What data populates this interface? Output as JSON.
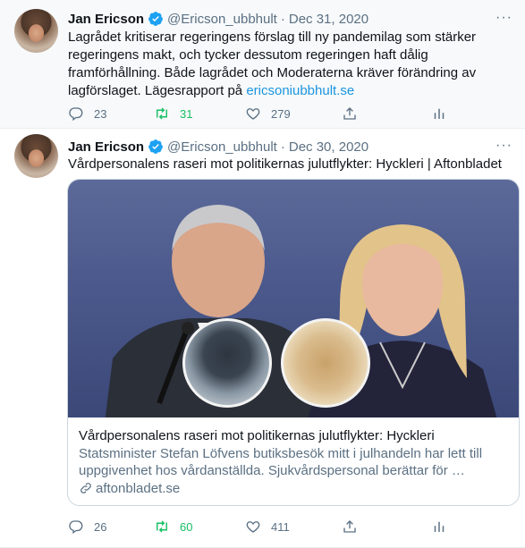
{
  "tweets": [
    {
      "name": "Jan Ericson",
      "handle": "@Ericson_ubbhult",
      "dot": "·",
      "date": "Dec 31, 2020",
      "more": "···",
      "text_line1": "Lagrådet kritiserar regeringens förslag till ny pandemilag som stärker",
      "text_line2": "regeringens makt, och tycker dessutom regeringen haft dålig",
      "text_line3": "framförhållning. Både lagrådet och Moderaterna kräver förändring av",
      "text_line4_prefix": "lagförslaget. Lägesrapport på ",
      "text_link": "ericsoniubbhult.se",
      "replies": "23",
      "retweets": "31",
      "likes": "279"
    },
    {
      "name": "Jan Ericson",
      "handle": "@Ericson_ubbhult",
      "dot": "·",
      "date": "Dec 30, 2020",
      "more": "···",
      "text_line1": "Vårdpersonalens raseri mot politikernas julutflykter: Hyckleri | Aftonbladet",
      "card": {
        "title": "Vårdpersonalens raseri mot politikernas julutflykter: Hyckleri",
        "desc_line1": "Statsminister Stefan Löfvens butiksbesök mitt i julhandeln har lett till",
        "desc_line2": "uppgivenhet hos vårdanställda. Sjukvårdspersonal berättar för …",
        "domain": "aftonbladet.se"
      },
      "replies": "26",
      "retweets": "60",
      "likes": "411"
    }
  ],
  "colors": {
    "text": "#0f1419",
    "secondary": "#5b7083",
    "link": "#1b95e0",
    "retweet": "#17bf63",
    "verified": "#1da1f2"
  },
  "icons": [
    "verified-badge-icon",
    "reply-icon",
    "retweet-icon",
    "like-icon",
    "share-icon",
    "analytics-icon",
    "link-icon"
  ]
}
